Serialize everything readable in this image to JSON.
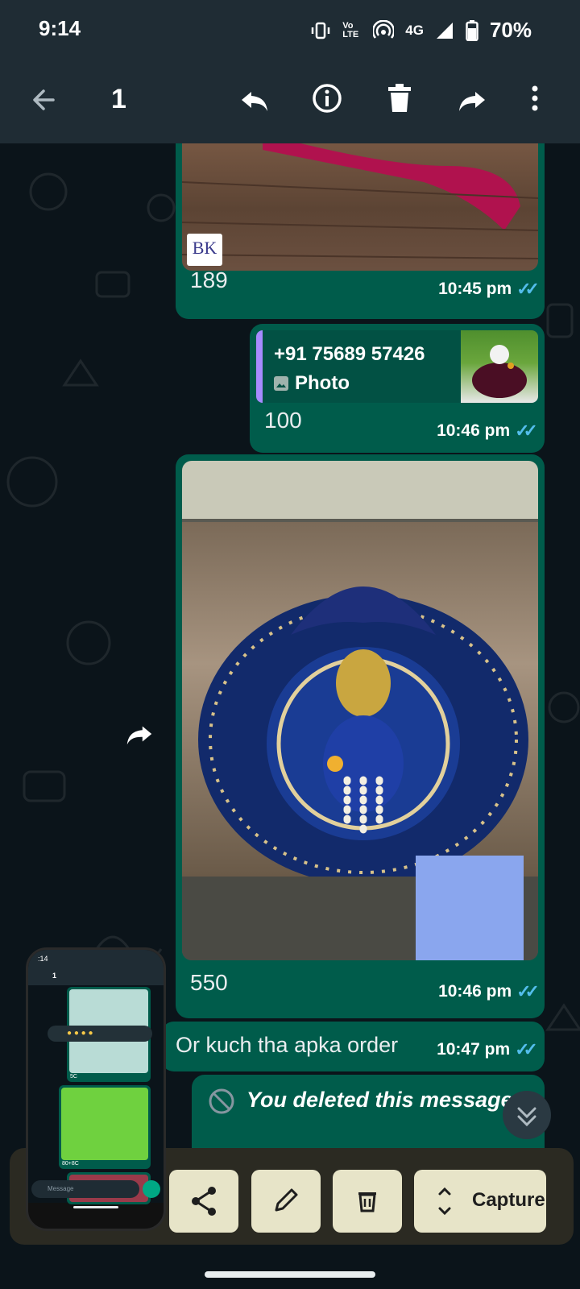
{
  "status_bar": {
    "time": "9:14",
    "network": "4G",
    "volte": "Vo LTE",
    "battery": "70%"
  },
  "app_bar": {
    "selected_count": "1",
    "icons": [
      "back-arrow-icon",
      "reply-icon",
      "info-icon",
      "delete-icon",
      "forward-icon",
      "more-vert-icon"
    ]
  },
  "messages": [
    {
      "caption": "189",
      "time": "10:45 pm",
      "type": "image",
      "logo_text": "BK"
    },
    {
      "caption": "100",
      "time": "10:46 pm",
      "type": "reply",
      "quote_sender": "+91 75689 57426",
      "quote_type": "Photo"
    },
    {
      "caption": "550",
      "time": "10:46 pm",
      "type": "image"
    },
    {
      "text": "Or kuch tha apka order",
      "time": "10:47 pm",
      "type": "text"
    },
    {
      "text": "You deleted this message",
      "type": "deleted"
    }
  ],
  "screenshot_toolbar": {
    "capture_label": "Capture",
    "buttons": [
      "share-icon",
      "edit-icon",
      "delete-icon",
      "expand-icon"
    ]
  },
  "mini_preview": {
    "time": ":14",
    "count": "1",
    "message_placeholder": "Message",
    "captions": [
      "5C",
      "80+8C"
    ]
  },
  "colors": {
    "outgoing_bubble": "#005c4b",
    "app_bar": "#1f2c34",
    "chat_background": "#0b141a",
    "read_ticks": "#53bdeb",
    "toolbar_button": "#e7e4c8"
  }
}
